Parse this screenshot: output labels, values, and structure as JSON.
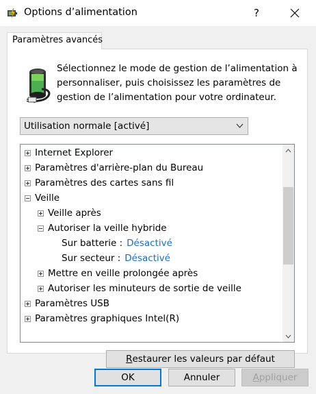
{
  "window": {
    "title": "Options d’alimentation",
    "help_label": "?"
  },
  "tab": {
    "label": "Paramètres avancés"
  },
  "description": "Sélectionnez le mode de gestion de l’alimentation à personnaliser, puis choisissez les paramètres de gestion de l’alimentation pour votre ordinateur.",
  "plan_select": {
    "value": "Utilisation normale [activé]"
  },
  "tree": {
    "items": [
      {
        "label": "Internet Explorer",
        "level": 0,
        "state": "collapsed"
      },
      {
        "label": "Paramètres d'arrière-plan du Bureau",
        "level": 0,
        "state": "collapsed"
      },
      {
        "label": "Paramètres des cartes sans fil",
        "level": 0,
        "state": "collapsed"
      },
      {
        "label": "Veille",
        "level": 0,
        "state": "expanded"
      },
      {
        "label": "Veille après",
        "level": 1,
        "state": "collapsed"
      },
      {
        "label": "Autoriser la veille hybride",
        "level": 1,
        "state": "expanded"
      },
      {
        "label": "Sur batterie :",
        "level": 2,
        "value": "Désactivé"
      },
      {
        "label": "Sur secteur :",
        "level": 2,
        "value": "Désactivé"
      },
      {
        "label": "Mettre en veille prolongée après",
        "level": 1,
        "state": "collapsed"
      },
      {
        "label": "Autoriser les minuteurs de sortie de veille",
        "level": 1,
        "state": "collapsed"
      },
      {
        "label": "Paramètres USB",
        "level": 0,
        "state": "collapsed"
      },
      {
        "label": "Paramètres graphiques Intel(R)",
        "level": 0,
        "state": "collapsed"
      }
    ]
  },
  "buttons": {
    "restore_prefix": "R",
    "restore_rest": "estaurer les valeurs par défaut",
    "ok": "OK",
    "cancel": "Annuler",
    "apply_prefix": "A",
    "apply_rest": "ppliquer"
  },
  "colors": {
    "link": "#1a6fc4",
    "accent": "#0078d7",
    "window_bg": "#f0f0f0"
  },
  "icons": {
    "app": "power-options-icon",
    "battery": "battery-plug-icon"
  }
}
